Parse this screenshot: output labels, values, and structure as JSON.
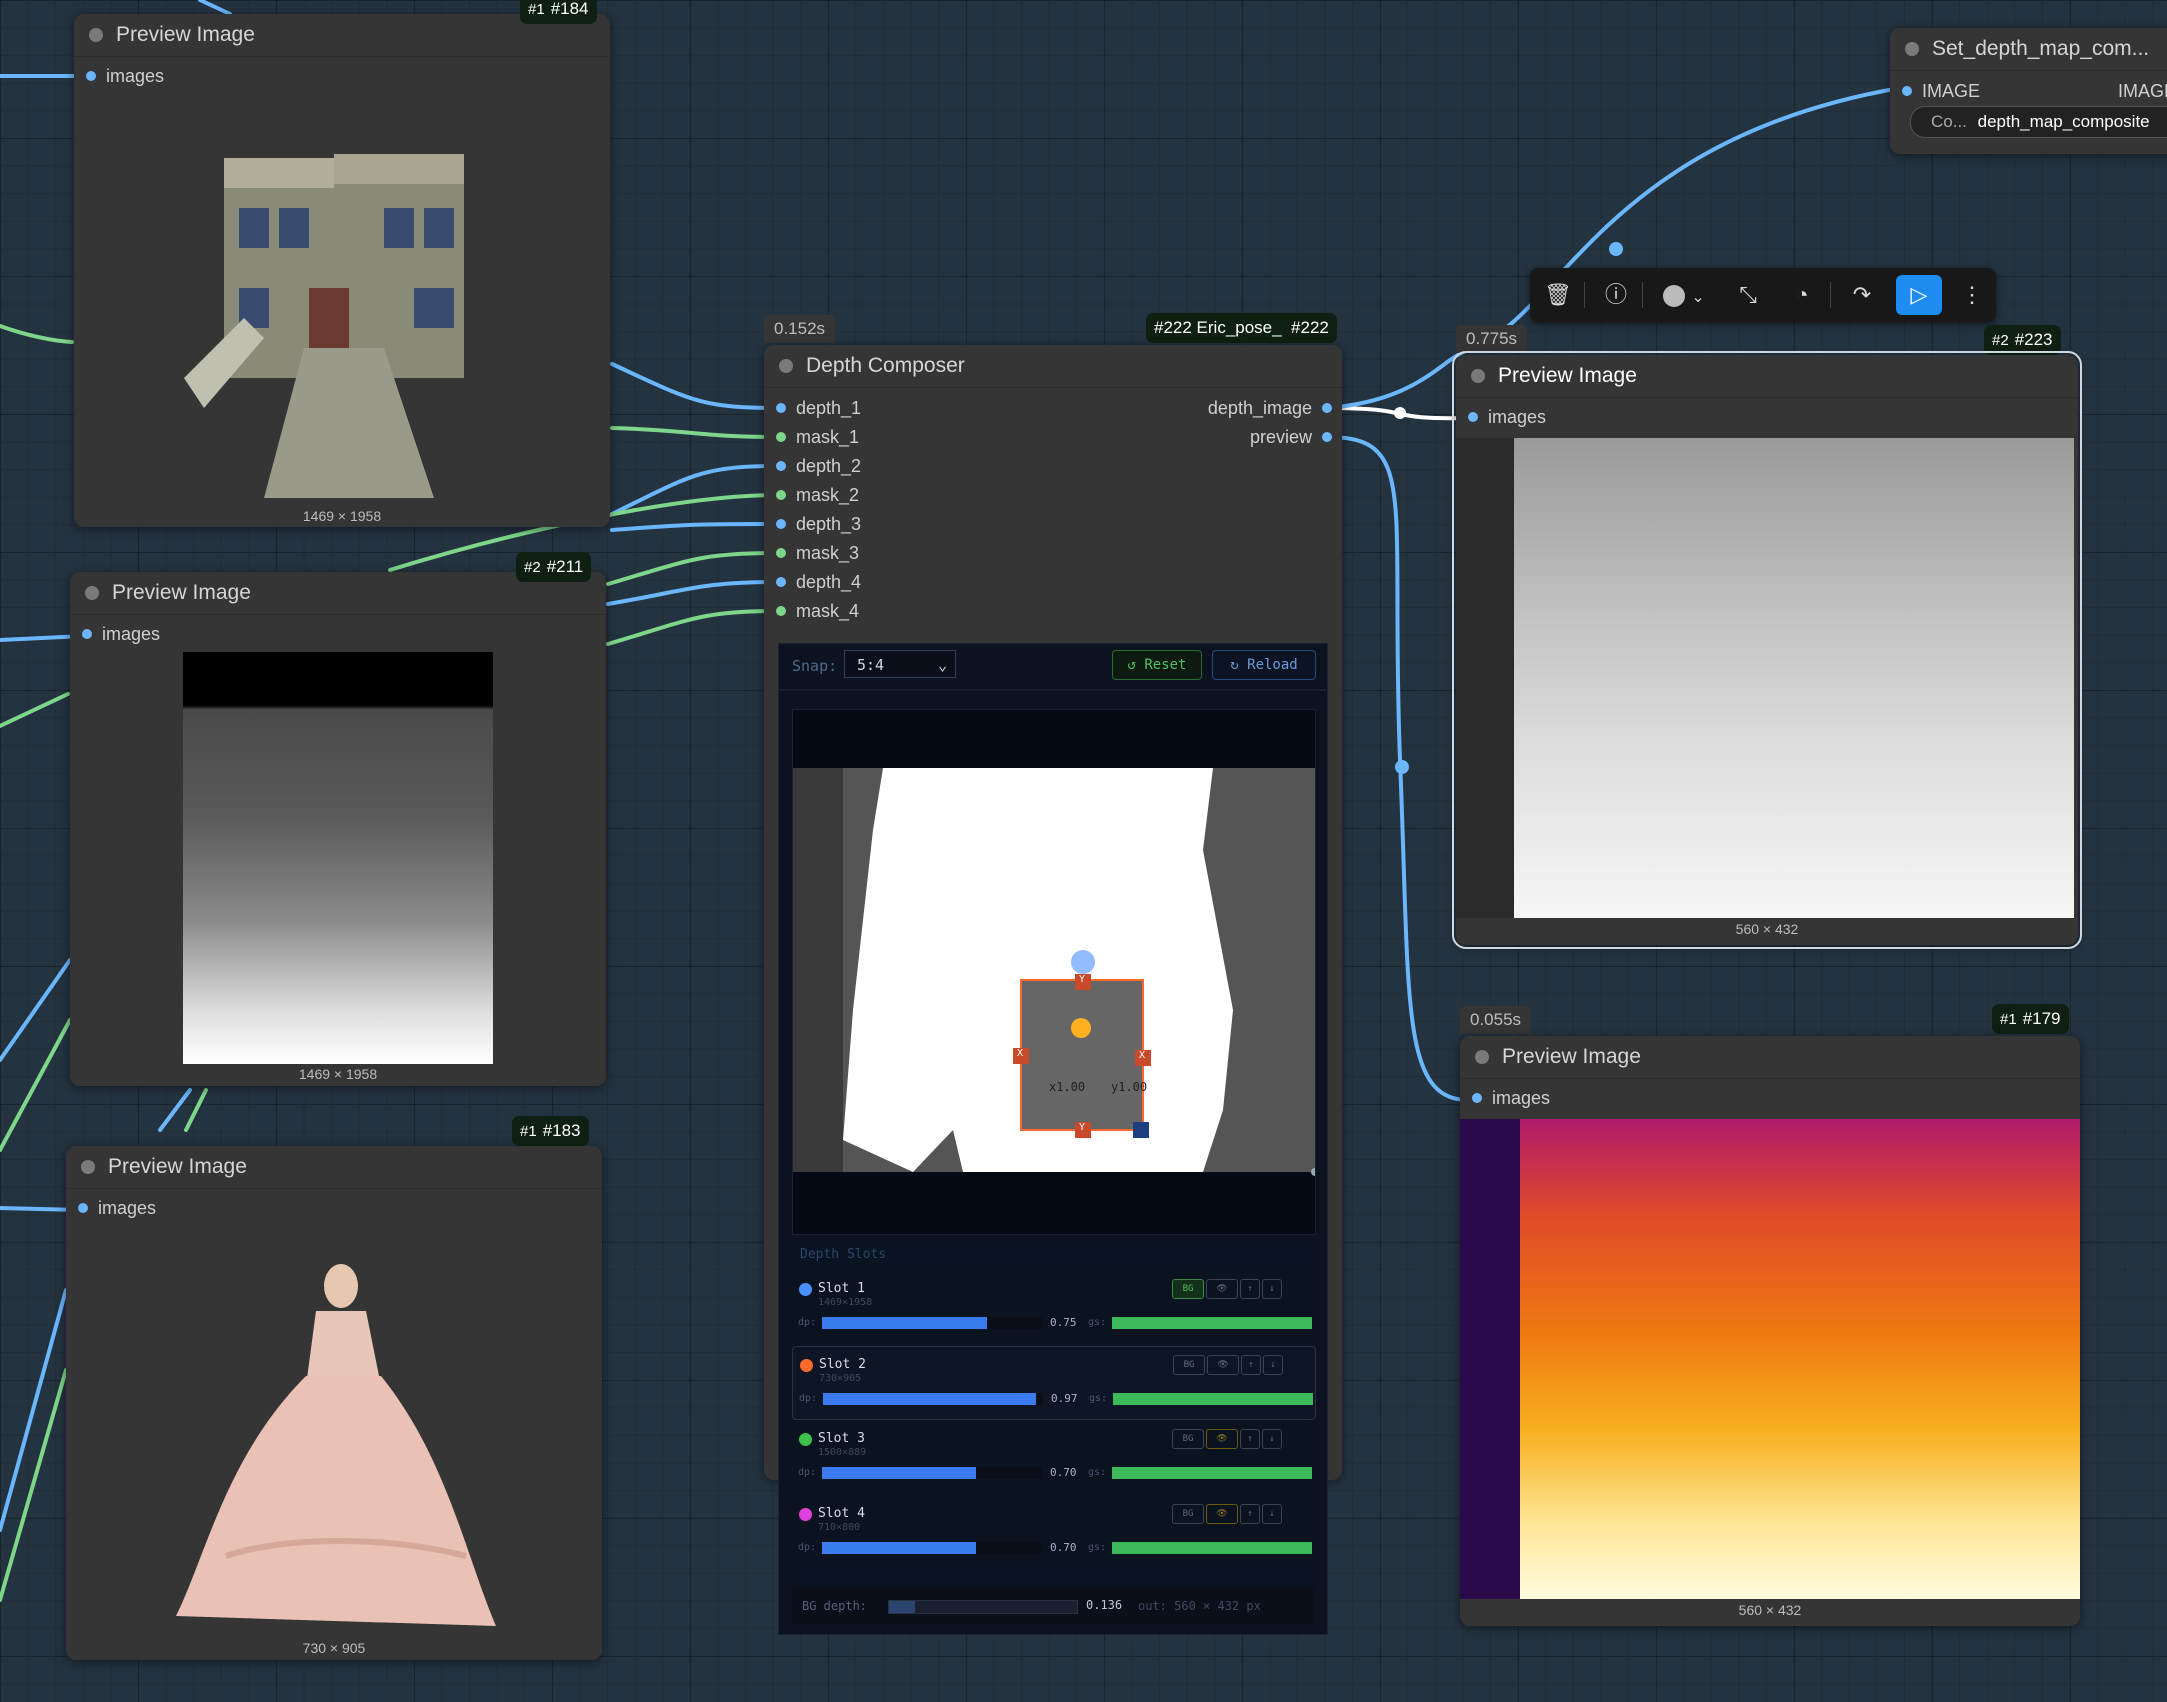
{
  "nodes": {
    "preview_184": {
      "title": "Preview Image",
      "input": "images",
      "dims": "1469 × 1958",
      "badge_num": "#1",
      "badge_id": "#184"
    },
    "preview_211": {
      "title": "Preview Image",
      "input": "images",
      "dims": "1469 × 1958",
      "badge_num": "#2",
      "badge_id": "#211"
    },
    "preview_183": {
      "title": "Preview Image",
      "input": "images",
      "dims": "730 × 905",
      "badge_num": "#1",
      "badge_id": "#183"
    },
    "depth_composer": {
      "title": "Depth Composer",
      "timing": "0.152s",
      "badge_label": "#222 Eric_pose_",
      "badge_id": "#222",
      "inputs": [
        "depth_1",
        "mask_1",
        "depth_2",
        "mask_2",
        "depth_3",
        "mask_3",
        "depth_4",
        "mask_4"
      ],
      "outputs": [
        "depth_image",
        "preview"
      ],
      "snap_label": "Snap:",
      "snap_value": "5:4",
      "reset_label": "↺ Reset",
      "reload_label": "↻ Reload",
      "handle_y": "Y",
      "handle_x": "X",
      "scale_x": "x1.00",
      "scale_y": "y1.00",
      "slots_header": "Depth Slots",
      "slots": [
        {
          "name": "Slot 1",
          "size": "1469×1958",
          "color": "#4a8fff",
          "dp_label": "dp:",
          "dp": "0.75",
          "dp_fill": 0.75,
          "gs_label": "gs:",
          "gs_fill": 1.0,
          "bg_active": true
        },
        {
          "name": "Slot 2",
          "size": "730×905",
          "color": "#ff6a2a",
          "dp_label": "dp:",
          "dp": "0.97",
          "dp_fill": 0.97,
          "gs_label": "gs:",
          "gs_fill": 1.0,
          "bg_active": false
        },
        {
          "name": "Slot 3",
          "size": "1500×889",
          "color": "#3cc24a",
          "dp_label": "dp:",
          "dp": "0.70",
          "dp_fill": 0.7,
          "gs_label": "gs:",
          "gs_fill": 1.0,
          "bg_active": false
        },
        {
          "name": "Slot 4",
          "size": "710×800",
          "color": "#e040e0",
          "dp_label": "dp:",
          "dp": "0.70",
          "dp_fill": 0.7,
          "gs_label": "gs:",
          "gs_fill": 1.0,
          "bg_active": false
        }
      ],
      "slot_btns": {
        "bg": "BG",
        "eye": "👁",
        "up": "↑",
        "down": "↓"
      },
      "bg_depth_label": "BG depth:",
      "bg_depth_value": "0.136",
      "bg_depth_fill": 0.136,
      "out_label": "out: 560 × 432 px"
    },
    "preview_223": {
      "title": "Preview Image",
      "input": "images",
      "dims": "560 × 432",
      "timing": "0.775s",
      "badge_num": "#2",
      "badge_id": "#223"
    },
    "preview_179": {
      "title": "Preview Image",
      "input": "images",
      "dims": "560 × 432",
      "timing": "0.055s",
      "badge_num": "#1",
      "badge_id": "#179"
    },
    "set_node": {
      "title": "Set_depth_map_com...",
      "input": "IMAGE",
      "output": "IMAGE",
      "widget_label": "Co...",
      "widget_value": "depth_map_composite"
    }
  },
  "toolbar": {
    "icons": [
      "trash-icon",
      "info-icon",
      "color-icon",
      "collapse-icon",
      "bypass-icon",
      "redo-icon",
      "run-icon",
      "more-icon"
    ]
  }
}
